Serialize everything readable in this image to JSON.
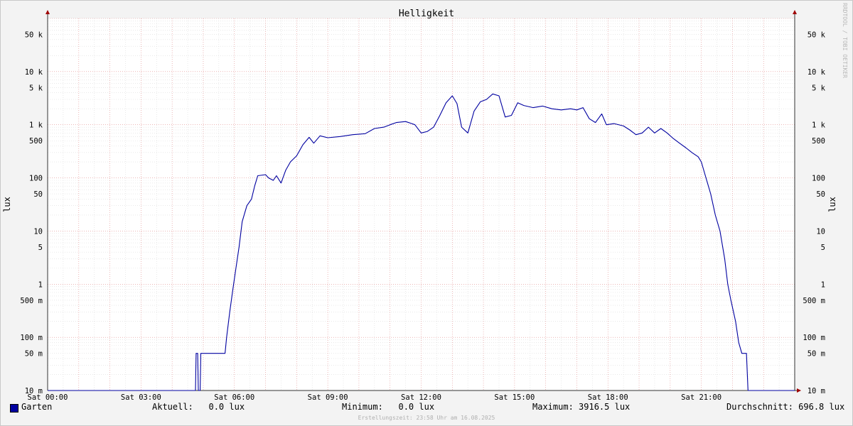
{
  "chart_data": {
    "type": "line",
    "title": "Helligkeit",
    "ylabel": "lux",
    "y_scale": "log",
    "ylim": [
      0.01,
      100000
    ],
    "xlim": [
      "Sat 00:00",
      "Sun 00:00"
    ],
    "grid": true,
    "y_ticks": [
      {
        "value": 0.01,
        "label": "10 m"
      },
      {
        "value": 0.05,
        "label": "50 m"
      },
      {
        "value": 0.1,
        "label": "100 m"
      },
      {
        "value": 0.5,
        "label": "500 m"
      },
      {
        "value": 1,
        "label": "1"
      },
      {
        "value": 5,
        "label": "5"
      },
      {
        "value": 10,
        "label": "10"
      },
      {
        "value": 50,
        "label": "50"
      },
      {
        "value": 100,
        "label": "100"
      },
      {
        "value": 500,
        "label": "500"
      },
      {
        "value": 1000,
        "label": "1 k"
      },
      {
        "value": 5000,
        "label": "5 k"
      },
      {
        "value": 10000,
        "label": "10 k"
      },
      {
        "value": 50000,
        "label": "50 k"
      }
    ],
    "x_ticks": [
      {
        "hour": 0,
        "label": "Sat 00:00"
      },
      {
        "hour": 3,
        "label": "Sat 03:00"
      },
      {
        "hour": 6,
        "label": "Sat 06:00"
      },
      {
        "hour": 9,
        "label": "Sat 09:00"
      },
      {
        "hour": 12,
        "label": "Sat 12:00"
      },
      {
        "hour": 15,
        "label": "Sat 15:00"
      },
      {
        "hour": 18,
        "label": "Sat 18:00"
      },
      {
        "hour": 21,
        "label": "Sat 21:00"
      }
    ],
    "series": [
      {
        "name": "Garten",
        "color": "#0000a0",
        "points": [
          [
            0,
            0.01
          ],
          [
            4.75,
            0.01
          ],
          [
            4.77,
            0.05
          ],
          [
            4.82,
            0.05
          ],
          [
            4.84,
            0.01
          ],
          [
            4.9,
            0.01
          ],
          [
            4.92,
            0.05
          ],
          [
            5.7,
            0.05
          ],
          [
            5.75,
            0.1
          ],
          [
            5.85,
            0.3
          ],
          [
            5.95,
            0.8
          ],
          [
            6.05,
            2
          ],
          [
            6.15,
            5
          ],
          [
            6.25,
            15
          ],
          [
            6.4,
            30
          ],
          [
            6.55,
            40
          ],
          [
            6.65,
            70
          ],
          [
            6.75,
            110
          ],
          [
            7.0,
            115
          ],
          [
            7.1,
            100
          ],
          [
            7.25,
            90
          ],
          [
            7.35,
            110
          ],
          [
            7.5,
            80
          ],
          [
            7.65,
            140
          ],
          [
            7.8,
            200
          ],
          [
            8.0,
            260
          ],
          [
            8.2,
            420
          ],
          [
            8.4,
            580
          ],
          [
            8.55,
            450
          ],
          [
            8.75,
            620
          ],
          [
            9.0,
            570
          ],
          [
            9.4,
            600
          ],
          [
            9.8,
            650
          ],
          [
            10.2,
            680
          ],
          [
            10.5,
            850
          ],
          [
            10.8,
            900
          ],
          [
            11.0,
            1000
          ],
          [
            11.2,
            1100
          ],
          [
            11.5,
            1150
          ],
          [
            11.7,
            1050
          ],
          [
            11.8,
            1000
          ],
          [
            12.0,
            700
          ],
          [
            12.2,
            750
          ],
          [
            12.4,
            900
          ],
          [
            12.6,
            1500
          ],
          [
            12.8,
            2600
          ],
          [
            13.0,
            3500
          ],
          [
            13.15,
            2500
          ],
          [
            13.3,
            900
          ],
          [
            13.5,
            700
          ],
          [
            13.7,
            1800
          ],
          [
            13.9,
            2700
          ],
          [
            14.1,
            3000
          ],
          [
            14.3,
            3800
          ],
          [
            14.5,
            3500
          ],
          [
            14.7,
            1400
          ],
          [
            14.9,
            1500
          ],
          [
            15.1,
            2600
          ],
          [
            15.3,
            2300
          ],
          [
            15.6,
            2100
          ],
          [
            15.9,
            2250
          ],
          [
            16.2,
            2000
          ],
          [
            16.5,
            1900
          ],
          [
            16.8,
            2000
          ],
          [
            17.0,
            1900
          ],
          [
            17.2,
            2100
          ],
          [
            17.4,
            1300
          ],
          [
            17.6,
            1100
          ],
          [
            17.8,
            1600
          ],
          [
            17.95,
            1000
          ],
          [
            18.2,
            1050
          ],
          [
            18.5,
            950
          ],
          [
            18.7,
            800
          ],
          [
            18.9,
            650
          ],
          [
            19.1,
            700
          ],
          [
            19.3,
            900
          ],
          [
            19.5,
            700
          ],
          [
            19.7,
            850
          ],
          [
            19.9,
            700
          ],
          [
            20.1,
            550
          ],
          [
            20.3,
            450
          ],
          [
            20.5,
            370
          ],
          [
            20.7,
            300
          ],
          [
            20.9,
            250
          ],
          [
            21.0,
            200
          ],
          [
            21.15,
            100
          ],
          [
            21.3,
            50
          ],
          [
            21.45,
            20
          ],
          [
            21.6,
            10
          ],
          [
            21.75,
            3
          ],
          [
            21.85,
            1
          ],
          [
            21.95,
            0.5
          ],
          [
            22.1,
            0.2
          ],
          [
            22.2,
            0.08
          ],
          [
            22.3,
            0.05
          ],
          [
            22.45,
            0.05
          ],
          [
            22.5,
            0.01
          ],
          [
            24,
            0.01
          ]
        ]
      }
    ]
  },
  "legend": {
    "series_name": "Garten",
    "current_label": "Aktuell:",
    "current_value": "0.0 lux",
    "minimum_label": "Minimum:",
    "minimum_value": "0.0 lux",
    "maximum_label": "Maximum:",
    "maximum_value": "3916.5 lux",
    "average_label": "Durchschnitt:",
    "average_value": "696.8 lux"
  },
  "footer": "Erstellungszeit: 23:58 Uhr am 16.08.2025",
  "watermark": "RRDTOOL / TOBI OETIKER"
}
